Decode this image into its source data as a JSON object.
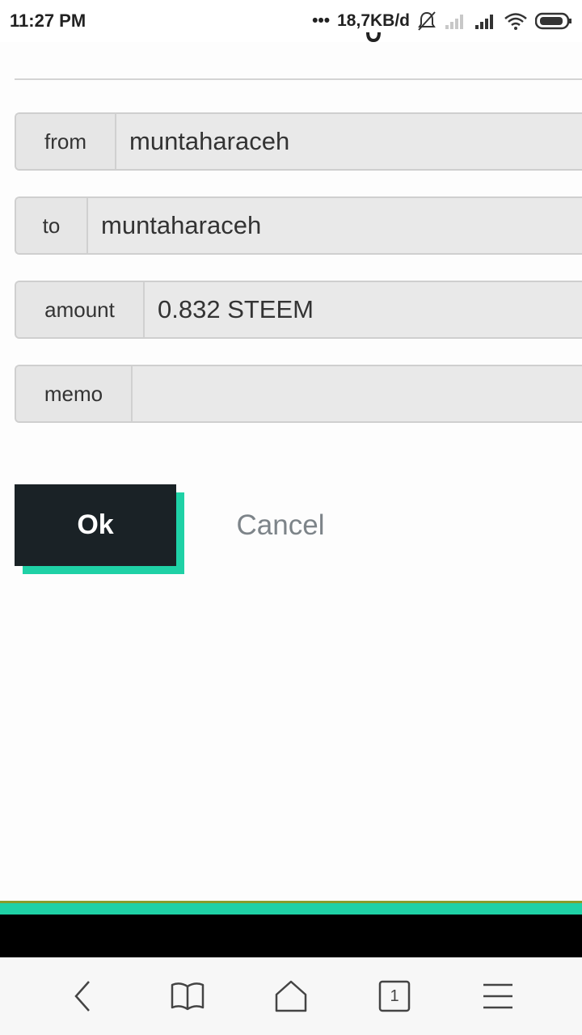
{
  "status_bar": {
    "time": "11:27 PM",
    "dots": "•••",
    "network_speed": "18,7KB/d",
    "icons": [
      "mute-icon",
      "signal-weak-icon",
      "signal-icon",
      "wifi-icon",
      "battery-icon"
    ]
  },
  "form": {
    "from": {
      "label": "from",
      "value": "muntaharaceh"
    },
    "to": {
      "label": "to",
      "value": "muntaharaceh"
    },
    "amount": {
      "label": "amount",
      "value": "0.832 STEEM"
    },
    "memo": {
      "label": "memo",
      "value": ""
    }
  },
  "buttons": {
    "ok_label": "Ok",
    "cancel_label": "Cancel"
  },
  "browser_nav": {
    "tab_count": "1",
    "icons": [
      "back-icon",
      "bookmarks-icon",
      "home-icon",
      "tabs-icon",
      "menu-icon"
    ]
  },
  "colors": {
    "accent": "#1fd1a6",
    "button_dark": "#1a2226",
    "input_bg": "#e9e9e9",
    "cancel_text": "#7d8489"
  }
}
